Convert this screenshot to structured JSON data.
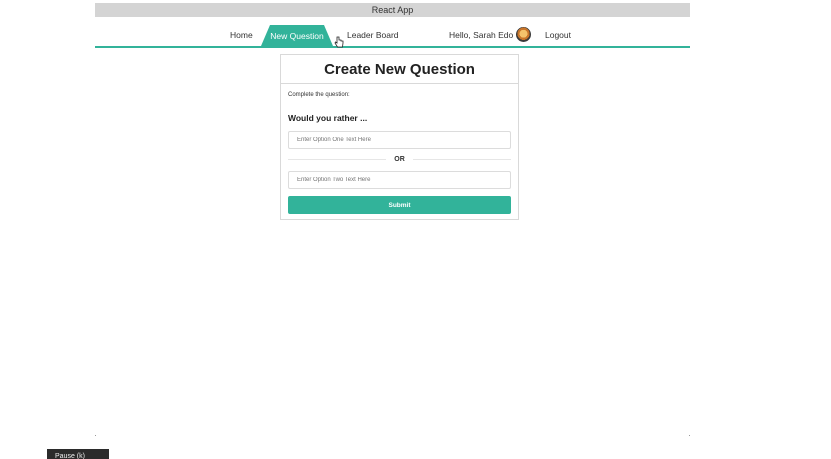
{
  "window": {
    "title": "React App"
  },
  "nav": {
    "home": "Home",
    "new_question": "New Question",
    "leader_board": "Leader Board",
    "greeting": "Hello, Sarah Edo",
    "avatar_icon": "avatar",
    "logout": "Logout",
    "active_tab": "New Question",
    "accent_color": "#32b39a"
  },
  "form": {
    "title": "Create New Question",
    "instructions": "Complete the question:",
    "prompt": "Would you rather ...",
    "option_one_placeholder": "Enter Option One Text Here",
    "option_one_value": "",
    "or_label": "OR",
    "option_two_placeholder": "Enter Option Two Text Here",
    "option_two_value": "",
    "submit_label": "Submit"
  },
  "overlay": {
    "tooltip": "Pause (k)"
  }
}
